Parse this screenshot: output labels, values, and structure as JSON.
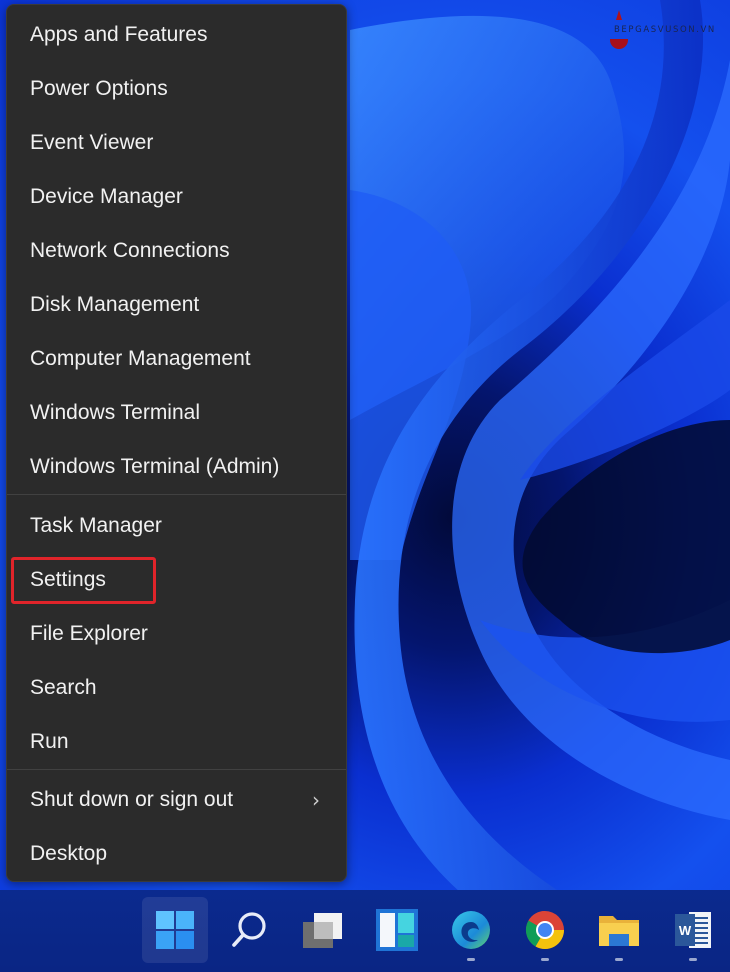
{
  "watermark": {
    "text": "BEPGASVUSON.VN"
  },
  "context_menu": {
    "groups": [
      [
        {
          "label": "Apps and Features"
        },
        {
          "label": "Power Options"
        },
        {
          "label": "Event Viewer"
        },
        {
          "label": "Device Manager"
        },
        {
          "label": "Network Connections"
        },
        {
          "label": "Disk Management"
        },
        {
          "label": "Computer Management"
        },
        {
          "label": "Windows Terminal"
        },
        {
          "label": "Windows Terminal (Admin)"
        }
      ],
      [
        {
          "label": "Task Manager"
        },
        {
          "label": "Settings",
          "highlighted": true
        },
        {
          "label": "File Explorer"
        },
        {
          "label": "Search"
        },
        {
          "label": "Run"
        }
      ],
      [
        {
          "label": "Shut down or sign out",
          "submenu": true,
          "chevron": "›"
        },
        {
          "label": "Desktop"
        }
      ]
    ],
    "highlight_color": "#e0242a"
  },
  "taskbar": {
    "items": [
      {
        "name": "start",
        "icon": "windows-logo-icon",
        "active": true,
        "running": false
      },
      {
        "name": "search",
        "icon": "search-icon",
        "active": false,
        "running": false
      },
      {
        "name": "task-view",
        "icon": "task-view-icon",
        "active": false,
        "running": false
      },
      {
        "name": "widgets",
        "icon": "widgets-icon",
        "active": false,
        "running": false
      },
      {
        "name": "edge",
        "icon": "edge-icon",
        "active": false,
        "running": true
      },
      {
        "name": "chrome",
        "icon": "chrome-icon",
        "active": false,
        "running": true
      },
      {
        "name": "file-explorer",
        "icon": "folder-icon",
        "active": false,
        "running": true
      },
      {
        "name": "word",
        "icon": "word-icon",
        "active": false,
        "running": true,
        "glyph": "W"
      }
    ]
  }
}
